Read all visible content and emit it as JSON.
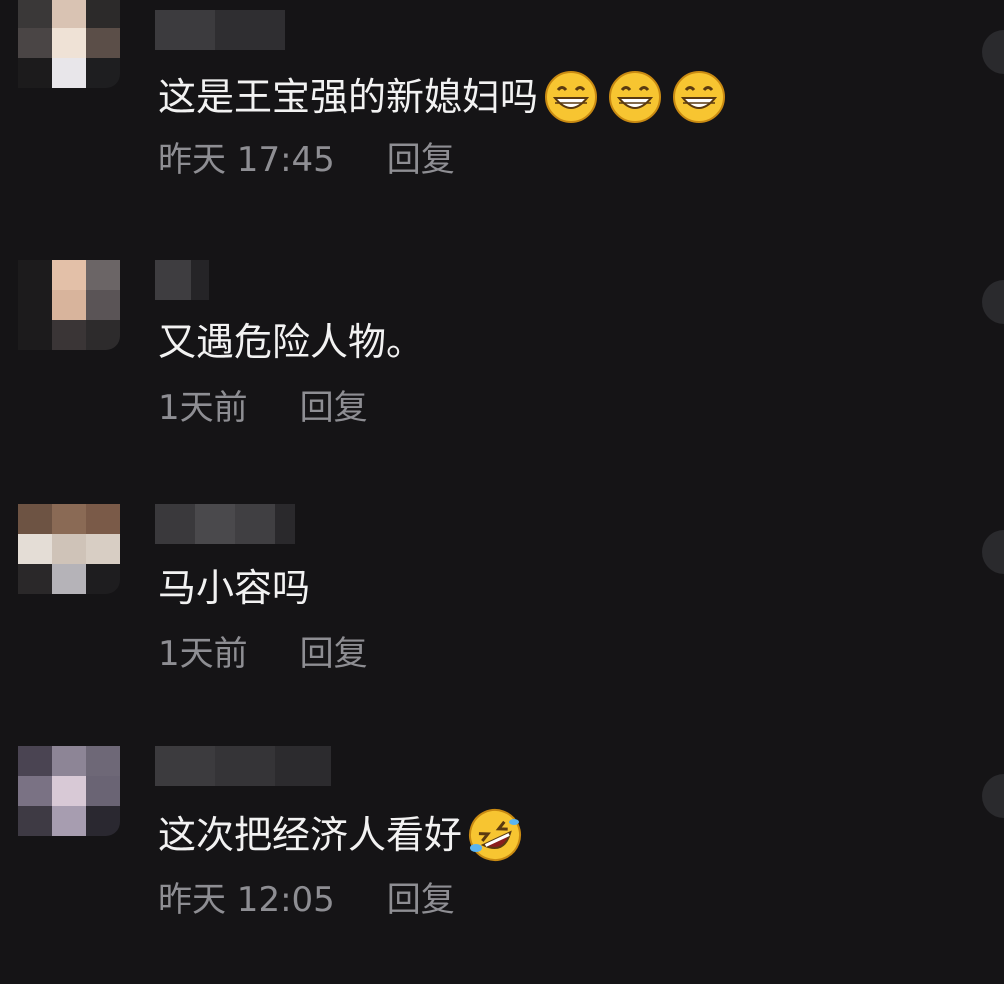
{
  "comments": [
    {
      "text": "这是王宝强的新媳妇吗",
      "emojis": [
        "grinning-face-icon",
        "grinning-face-icon",
        "grinning-face-icon"
      ],
      "time": "昨天 17:45",
      "reply_label": "回复"
    },
    {
      "text": "又遇危险人物。",
      "emojis": [],
      "time": "1天前",
      "reply_label": "回复"
    },
    {
      "text": "马小容吗",
      "emojis": [],
      "time": "1天前",
      "reply_label": "回复"
    },
    {
      "text": "这次把经济人看好",
      "emojis": [
        "rolling-on-floor-laughing-icon"
      ],
      "time": "昨天 12:05",
      "reply_label": "回复"
    }
  ],
  "colors": {
    "background": "#151416",
    "comment_text": "#f2f2f2",
    "meta_text": "#8e8e93"
  }
}
